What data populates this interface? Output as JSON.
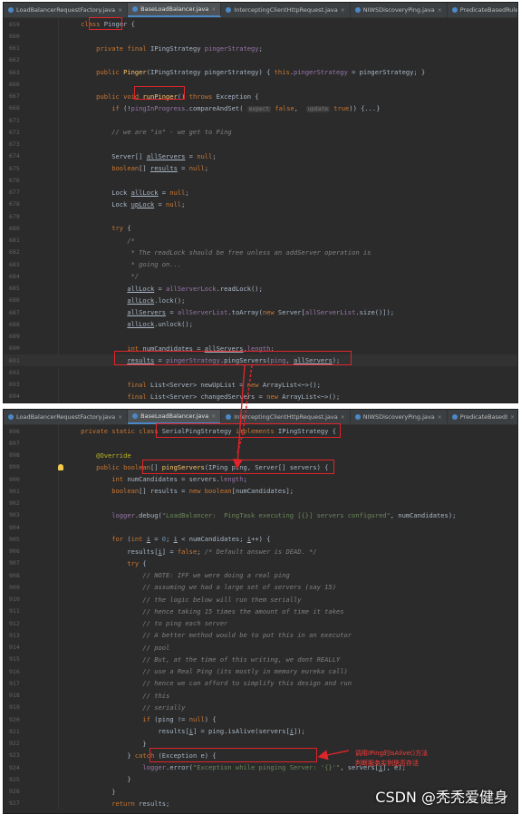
{
  "top_panel": {
    "tabs": [
      {
        "label": "LoadBalancerRequestFactory.java",
        "active": false
      },
      {
        "label": "BaseLoadBalancer.java",
        "active": true
      },
      {
        "label": "InterceptingClientHttpRequest.java",
        "active": false
      },
      {
        "label": "NIWSDiscoveryPing.java",
        "active": false
      },
      {
        "label": "PredicateBasedRule.java",
        "active": false
      }
    ],
    "lines": [
      {
        "num": "659",
        "html": "    <span class='kw'>class</span> <span class='rb'>Pinger</span> {"
      },
      {
        "num": "660",
        "html": ""
      },
      {
        "num": "661",
        "html": "        <span class='kw'>private final</span> IPingStrategy <span class='fld'>pingerStrategy</span>;"
      },
      {
        "num": "662",
        "html": ""
      },
      {
        "num": "663",
        "html": "        <span class='kw'>public</span> <span class='fn'>Pinger</span>(IPingStrategy pingerStrategy) { <span class='kw'>this</span>.<span class='fld'>pingerStrategy</span> = pingerStrategy; }"
      },
      {
        "num": "666",
        "html": ""
      },
      {
        "num": "667",
        "html": "        <span class='kw'>public void</span> <span class='fn'>runPinger</span>() <span class='kw'>throws</span> Exception {"
      },
      {
        "num": "668",
        "html": "            <span class='kw'>if</span> (!<span class='fld'>pingInProgress</span>.compareAndSet( <span class='hint'>expect</span> <span class='kw'>false</span>,  <span class='hint'>update</span> <span class='kw'>true</span>)) {...}"
      },
      {
        "num": "671",
        "html": ""
      },
      {
        "num": "672",
        "html": "            <span class='cm'>// we are \"in\" - we get to Ping</span>"
      },
      {
        "num": "673",
        "html": ""
      },
      {
        "num": "674",
        "html": "            Server[] <u>allServers</u> = <span class='kw'>null</span>;"
      },
      {
        "num": "675",
        "html": "            <span class='kw'>boolean</span>[] <u>results</u> = <span class='kw'>null</span>;"
      },
      {
        "num": "676",
        "html": ""
      },
      {
        "num": "677",
        "html": "            Lock <u>allLock</u> = <span class='kw'>null</span>;"
      },
      {
        "num": "678",
        "html": "            Lock <u>upLock</u> = <span class='kw'>null</span>;"
      },
      {
        "num": "679",
        "html": ""
      },
      {
        "num": "680",
        "html": "            <span class='kw'>try</span> {"
      },
      {
        "num": "681",
        "html": "                <span class='cm'>/*</span>"
      },
      {
        "num": "682",
        "html": "                <span class='cm'> * The readLock should be free unless an addServer operation is</span>"
      },
      {
        "num": "683",
        "html": "                <span class='cm'> * going on...</span>"
      },
      {
        "num": "684",
        "html": "                <span class='cm'> */</span>"
      },
      {
        "num": "685",
        "html": "                <u>allLock</u> = <span class='fld'>allServerLock</span>.readLock();"
      },
      {
        "num": "686",
        "html": "                <u>allLock</u>.lock();"
      },
      {
        "num": "687",
        "html": "                <u>allServers</u> = <span class='fld'>allServerList</span>.toArray(<span class='kw'>new</span> Server[<span class='fld'>allServerList</span>.size()]);"
      },
      {
        "num": "688",
        "html": "                <u>allLock</u>.unlock();"
      },
      {
        "num": "689",
        "html": ""
      },
      {
        "num": "690",
        "html": "                <span class='kw'>int</span> numCandidates = <u>allServers</u>.<span class='fld'>length</span>;"
      },
      {
        "num": "691",
        "html": "                <u>results</u> = <span class='fld'>pingerStrategy</span>.pingServers(<span class='fld'>ping</span>, <u>allServers</u>);",
        "hl": true
      },
      {
        "num": "692",
        "html": ""
      },
      {
        "num": "693",
        "html": "                <span class='kw'>final</span> List&lt;Server&gt; newUpList = <span class='kw'>new</span> ArrayList&lt;~&gt;();"
      },
      {
        "num": "694",
        "html": "                <span class='kw'>final</span> List&lt;Server&gt; changedServers = <span class='kw'>new</span> ArrayList&lt;~&gt;();"
      }
    ]
  },
  "bottom_panel": {
    "tabs": [
      {
        "label": "LoadBalancerRequestFactory.java",
        "active": false
      },
      {
        "label": "BaseLoadBalancer.java",
        "active": true
      },
      {
        "label": "InterceptingClientHttpRequest.java",
        "active": false
      },
      {
        "label": "NIWSDiscoveryPing.java",
        "active": false
      },
      {
        "label": "PredicateBasedI",
        "active": false
      }
    ],
    "lines": [
      {
        "num": "896",
        "html": "    <span class='kw'>private static class</span> SerialPingStrategy <span class='kw'>implements</span> IPingStrategy {"
      },
      {
        "num": "897",
        "html": ""
      },
      {
        "num": "898",
        "html": "        <span class='ann'>@Override</span>"
      },
      {
        "num": "899",
        "html": "        <span class='kw'>public boolean</span>[] <span class='fn'>pingServers</span>(IPing ping, Server[] servers) {",
        "marker": true
      },
      {
        "num": "900",
        "html": "            <span class='kw'>int</span> numCandidates = servers.<span class='fld'>length</span>;"
      },
      {
        "num": "901",
        "html": "            <span class='kw'>boolean</span>[] results = <span class='kw'>new boolean</span>[numCandidates];"
      },
      {
        "num": "902",
        "html": ""
      },
      {
        "num": "903",
        "html": "            <span class='fld'>logger</span>.debug(<span class='str'>\"LoadBalancer:  PingTask executing [{}] servers configured\"</span>, numCandidates);"
      },
      {
        "num": "904",
        "html": ""
      },
      {
        "num": "905",
        "html": "            <span class='kw'>for</span> (<span class='kw'>int</span> <u>i</u> = <span class='num'>0</span>; <u>i</u> &lt; numCandidates; <u>i</u>++) {"
      },
      {
        "num": "906",
        "html": "                results[<u>i</u>] = <span class='kw'>false</span>; <span class='cm'>/* Default answer is DEAD. */</span>"
      },
      {
        "num": "907",
        "html": "                <span class='kw'>try</span> {"
      },
      {
        "num": "908",
        "html": "                    <span class='cm'>// NOTE: IFF we were doing a real ping</span>"
      },
      {
        "num": "909",
        "html": "                    <span class='cm'>// assuming we had a large set of servers (say 15)</span>"
      },
      {
        "num": "910",
        "html": "                    <span class='cm'>// the logic below will run them serially</span>"
      },
      {
        "num": "911",
        "html": "                    <span class='cm'>// hence taking 15 times the amount of time it takes</span>"
      },
      {
        "num": "912",
        "html": "                    <span class='cm'>// to ping each server</span>"
      },
      {
        "num": "913",
        "html": "                    <span class='cm'>// A better method would be to put this in an executor</span>"
      },
      {
        "num": "914",
        "html": "                    <span class='cm'>// pool</span>"
      },
      {
        "num": "915",
        "html": "                    <span class='cm'>// But, at the time of this writing, we dont REALLY</span>"
      },
      {
        "num": "916",
        "html": "                    <span class='cm'>// use a Real Ping (its mostly in memory eureka call)</span>"
      },
      {
        "num": "917",
        "html": "                    <span class='cm'>// hence we can afford to simplify this design and run</span>"
      },
      {
        "num": "918",
        "html": "                    <span class='cm'>// this</span>"
      },
      {
        "num": "919",
        "html": "                    <span class='cm'>// serially</span>"
      },
      {
        "num": "920",
        "html": "                    <span class='kw'>if</span> (ping != <span class='kw'>null</span>) {"
      },
      {
        "num": "921",
        "html": "                        results[<u>i</u>] = ping.isAlive(servers[<u>i</u>]);"
      },
      {
        "num": "922",
        "html": "                    }"
      },
      {
        "num": "923",
        "html": "                } <span class='kw'>catch</span> (Exception e) {"
      },
      {
        "num": "924",
        "html": "                    <span class='fld'>logger</span>.error(<span class='str'>\"Exception while pinging Server: '{}'\"</span>, servers[<u>i</u>], e);"
      },
      {
        "num": "925",
        "html": "                }"
      },
      {
        "num": "926",
        "html": "            }"
      },
      {
        "num": "927",
        "html": "            <span class='kw'>return</span> results;"
      }
    ]
  },
  "annotation": {
    "line1": "调用IPing的isAlive()方法",
    "line2": "判断服务实例是否存活"
  },
  "watermark": "CSDN @秃秃爱健身",
  "colors": {
    "highlight_box": "#e0242a",
    "editor_bg": "#2b2b2b"
  }
}
